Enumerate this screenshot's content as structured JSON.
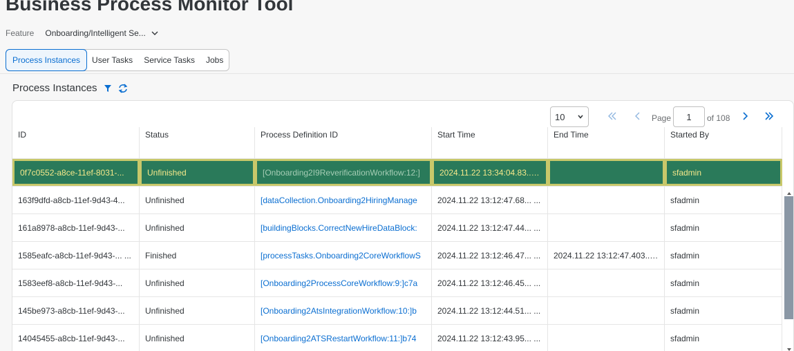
{
  "app": {
    "title": "Business Process Monitor Tool"
  },
  "feature": {
    "label": "Feature",
    "value": "Onboarding/Intelligent Se..."
  },
  "tabs": [
    {
      "label": "Process Instances",
      "active": true
    },
    {
      "label": "User Tasks",
      "active": false
    },
    {
      "label": "Service Tasks",
      "active": false
    },
    {
      "label": "Jobs",
      "active": false
    }
  ],
  "section": {
    "title": "Process Instances"
  },
  "pager": {
    "page_size": "10",
    "page_label": "Page",
    "current_page": "1",
    "of_label": "of 108"
  },
  "table": {
    "columns": [
      "ID",
      "Status",
      "Process Definition ID",
      "Start Time",
      "End Time",
      "Started By"
    ],
    "rows": [
      {
        "id": "0f7c0552-a8ce-11ef-8031-...",
        "status": "Unfinished",
        "process": "[Onboarding2I9ReverificationWorkflow:12:]",
        "start": "2024.11.22 13:34:04.83... ...",
        "end": "",
        "by": "sfadmin",
        "selected": true
      },
      {
        "id": "163f9dfd-a8cb-11ef-9d43-4...",
        "status": "Unfinished",
        "process": "[dataCollection.Onboarding2HiringManage",
        "start": "2024.11.22 13:12:47.68... ...",
        "end": "",
        "by": "sfadmin"
      },
      {
        "id": "161a8978-a8cb-11ef-9d43-...",
        "status": "Unfinished",
        "process": "[buildingBlocks.CorrectNewHireDataBlock:",
        "start": "2024.11.22 13:12:47.44... ...",
        "end": "",
        "by": "sfadmin"
      },
      {
        "id": "1585eafc-a8cb-11ef-9d43-... ...",
        "status": "Finished",
        "process": "[processTasks.Onboarding2CoreWorkflowS",
        "start": "2024.11.22 13:12:46.47... ...",
        "end": "2024.11.22 13:12:47.403... ...",
        "by": "sfadmin"
      },
      {
        "id": "1583eef8-a8cb-11ef-9d43-...",
        "status": "Unfinished",
        "process": "[Onboarding2ProcessCoreWorkflow:9:]c7a",
        "start": "2024.11.22 13:12:46.45... ...",
        "end": "",
        "by": "sfadmin"
      },
      {
        "id": "145be973-a8cb-11ef-9d43-...",
        "status": "Unfinished",
        "process": "[Onboarding2AtsIntegrationWorkflow:10:]b",
        "start": "2024.11.22 13:12:44.51... ...",
        "end": "",
        "by": "sfadmin"
      },
      {
        "id": "14045455-a8cb-11ef-9d43-...",
        "status": "Unfinished",
        "process": "[Onboarding2ATSRestartWorkflow:11:]b74",
        "start": "2024.11.22 13:12:43.95... ...",
        "end": "",
        "by": "sfadmin"
      }
    ]
  },
  "icons": {
    "filter": "filter-icon",
    "refresh": "refresh-icon",
    "first": "first-page-icon",
    "prev": "previous-page-icon",
    "next": "next-page-icon",
    "last": "last-page-icon"
  },
  "colors": {
    "accent": "#0a6ed1",
    "selected_row": "#2a7a5a",
    "selected_border": "#c8c86a"
  }
}
